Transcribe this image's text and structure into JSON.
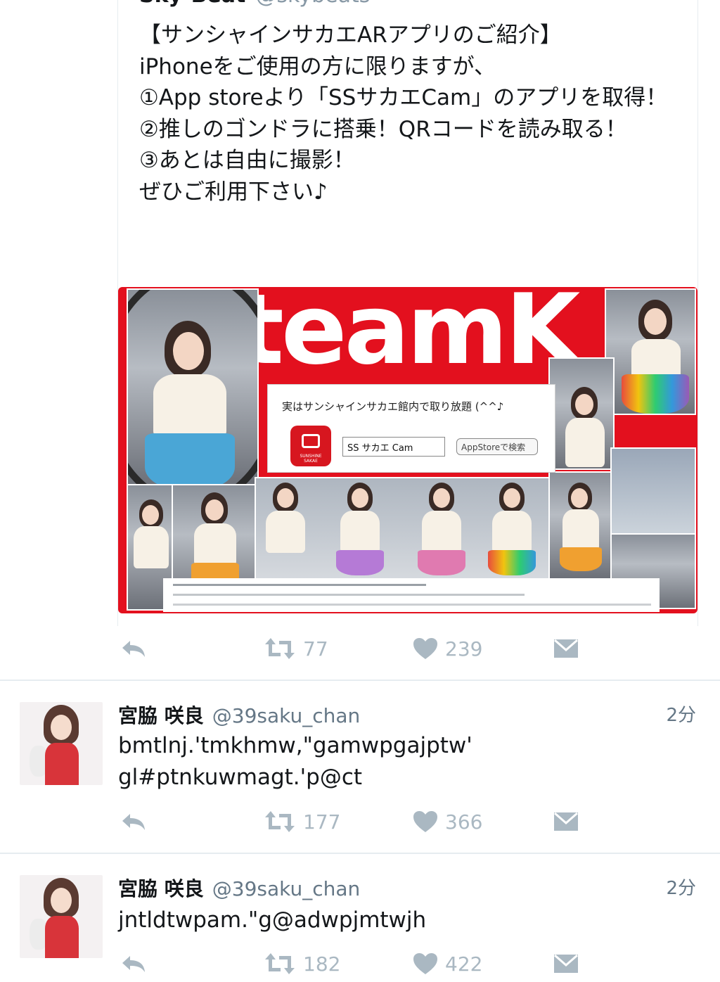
{
  "tweet1": {
    "author_cut": "Sky-Beat",
    "handle_cut": "@skybeats",
    "text": "【サンシャインサカエARアプリのご紹介】\niPhoneをご使用の方に限りますが、\n①App storeより「SSサカエCam」のアプリを取得！\n②推しのゴンドラに搭乗！QRコードを読み取る！\n③あとは自由に撮影！\nぜひご利用下さい♪",
    "media": {
      "banner": "teamK II",
      "caption": "実はサンシャインサカエ館内で取り放題 (^^♪",
      "app_icon_label": "SUNSHINE SAKAE",
      "search_value": "SS サカエ Cam",
      "store_button": "AppStoreで検索"
    },
    "retweets": "77",
    "likes": "239"
  },
  "tweet2": {
    "name": "宮脇 咲良",
    "handle": "@39saku_chan",
    "time": "2分",
    "text": "bmtlnj.'tmkhmw,\"gamwpgajptw'\ngl#ptnkuwmagt.'p@ct",
    "retweets": "177",
    "likes": "366"
  },
  "tweet3": {
    "name": "宮脇 咲良",
    "handle": "@39saku_chan",
    "time": "2分",
    "text": "jntldtwpam.\"g@adwpjmtwjh",
    "retweets": "182",
    "likes": "422"
  },
  "colors": {
    "action_gray": "#aab8c2",
    "handle_gray": "#657786",
    "banner_red": "#e3101e"
  },
  "icons": [
    "reply-icon",
    "retweet-icon",
    "like-icon",
    "message-icon"
  ]
}
